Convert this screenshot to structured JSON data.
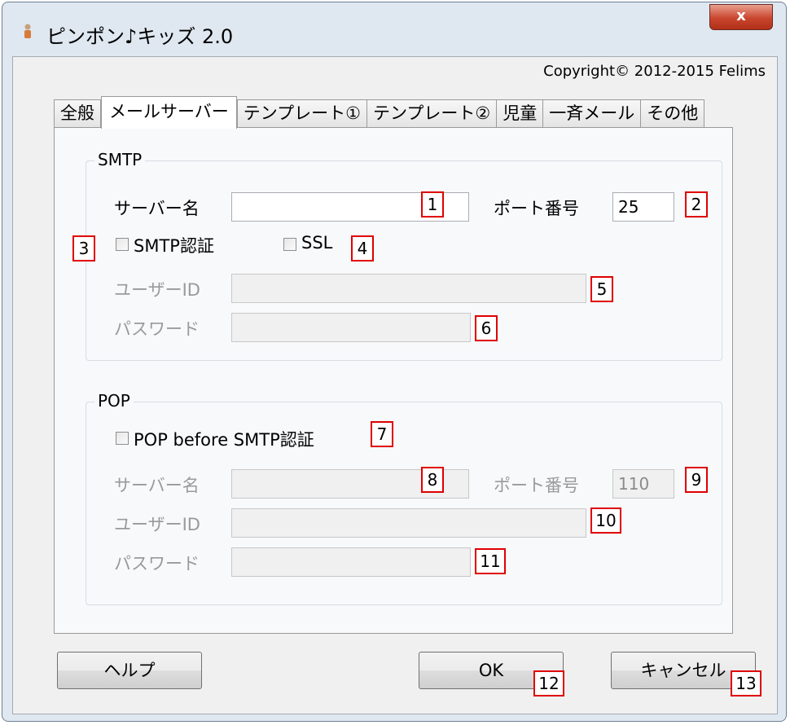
{
  "window": {
    "title": "ピンポン♪キッズ 2.0",
    "close_label": "x",
    "copyright": "Copyright© 2012-2015 Felims"
  },
  "tabs": [
    "全般",
    "メールサーバー",
    "テンプレート①",
    "テンプレート②",
    "児童",
    "一斉メール",
    "その他"
  ],
  "active_tab": "メールサーバー",
  "smtp": {
    "title": "SMTP",
    "server_label": "サーバー名",
    "server_value": "",
    "port_label": "ポート番号",
    "port_value": "25",
    "auth_label": "SMTP認証",
    "auth_checked": false,
    "ssl_label": "SSL",
    "ssl_checked": false,
    "user_label": "ユーザーID",
    "user_value": "",
    "password_label": "パスワード",
    "password_value": ""
  },
  "pop": {
    "title": "POP",
    "pbs_label": "POP before SMTP認証",
    "pbs_checked": false,
    "server_label": "サーバー名",
    "server_value": "",
    "port_label": "ポート番号",
    "port_value": "110",
    "user_label": "ユーザーID",
    "user_value": "",
    "password_label": "パスワード",
    "password_value": ""
  },
  "markers": [
    "1",
    "2",
    "3",
    "4",
    "5",
    "6",
    "7",
    "8",
    "9",
    "10",
    "11",
    "12",
    "13"
  ],
  "buttons": {
    "help": "ヘルプ",
    "ok": "OK",
    "cancel": "キャンセル"
  },
  "colors": {
    "marker_border": "#e00000",
    "close_button": "#c9452e",
    "disabled_text": "#9a9a9a"
  }
}
